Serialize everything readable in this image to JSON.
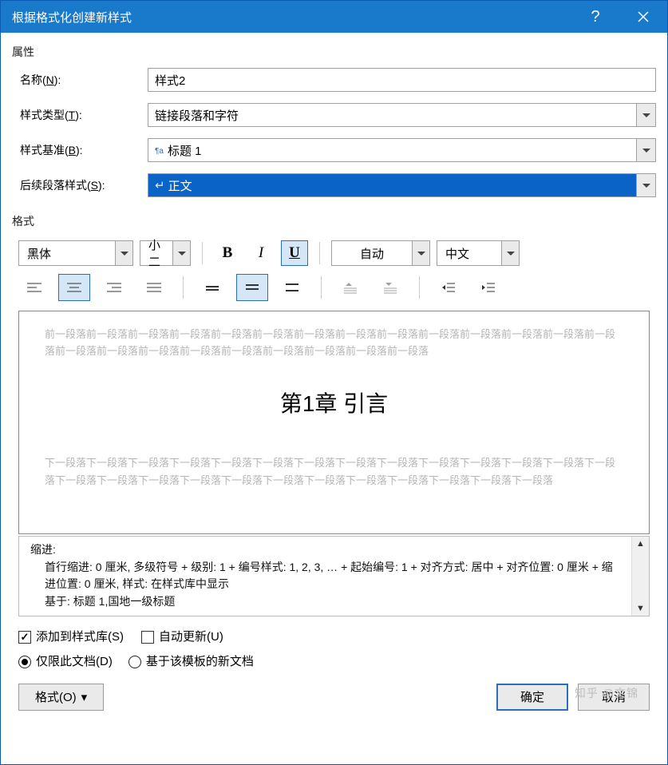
{
  "title": "根据格式化创建新样式",
  "sections": {
    "properties": "属性",
    "format": "格式"
  },
  "props": {
    "name_label": "名称(N):",
    "name_u": "N",
    "type_label": "样式类型(T):",
    "type_u": "T",
    "base_label": "样式基准(B):",
    "base_u": "B",
    "next_label": "后续段落样式(S):",
    "next_u": "S",
    "name_value": "样式2",
    "type_value": "链接段落和字符",
    "base_value": "标题 1",
    "next_value": "正文"
  },
  "format_toolbar": {
    "font": "黑体",
    "size": "小二",
    "color": "自动",
    "lang": "中文",
    "bold": "B",
    "italic": "I",
    "underline": "U"
  },
  "preview": {
    "before": "前一段落前一段落前一段落前一段落前一段落前一段落前一段落前一段落前一段落前一段落前一段落前一段落前一段落前一段落前一段落前一段落前一段落前一段落前一段落前一段落前一段落前一段落前一段落",
    "heading": "第1章 引言",
    "after": "下一段落下一段落下一段落下一段落下一段落下一段落下一段落下一段落下一段落下一段落下一段落下一段落下一段落下一段落下一段落下一段落下一段落下一段落下一段落下一段落下一段落下一段落下一段落下一段落下一段落下一段落"
  },
  "description": {
    "l1": "缩进:",
    "l2": "首行缩进: 0 厘米, 多级符号 + 级别: 1 + 编号样式: 1, 2, 3, … + 起始编号: 1 + 对齐方式: 居中 + 对齐位置: 0 厘米 + 缩进位置: 0 厘米, 样式: 在样式库中显示",
    "l3": "基于: 标题 1,国地一级标题"
  },
  "checks": {
    "add_gallery": "添加到样式库(S)",
    "auto_update": "自动更新(U)"
  },
  "radios": {
    "this_doc": "仅限此文档(D)",
    "template": "基于该模板的新文档"
  },
  "footer": {
    "format_btn": "格式(O)",
    "ok": "确定",
    "cancel": "取消"
  },
  "watermark": "知乎 @文锦"
}
